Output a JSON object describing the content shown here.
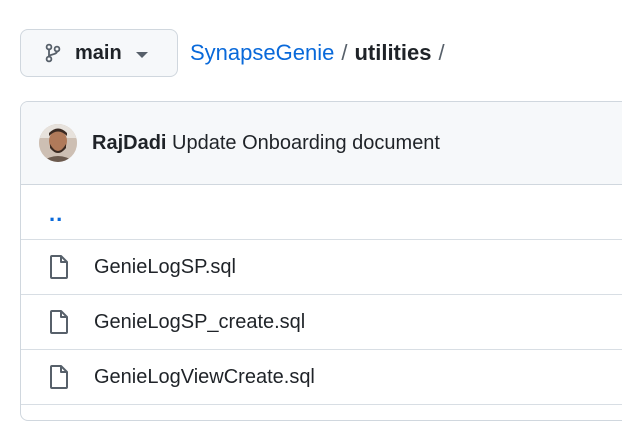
{
  "branch": {
    "name": "main",
    "icon": "git-branch-icon"
  },
  "breadcrumb": {
    "repo": "SynapseGenie",
    "separator": "/",
    "folder": "utilities",
    "trailing": "/"
  },
  "commit": {
    "author": "RajDadi",
    "message": "Update Onboarding document"
  },
  "parent_dir": {
    "label": ".."
  },
  "files": [
    {
      "name": "GenieLogSP.sql",
      "icon": "file-icon"
    },
    {
      "name": "GenieLogSP_create.sql",
      "icon": "file-icon"
    },
    {
      "name": "GenieLogViewCreate.sql",
      "icon": "file-icon"
    }
  ],
  "colors": {
    "link": "#0969da",
    "border": "#d0d7de",
    "header_bg": "#f6f8fa"
  }
}
